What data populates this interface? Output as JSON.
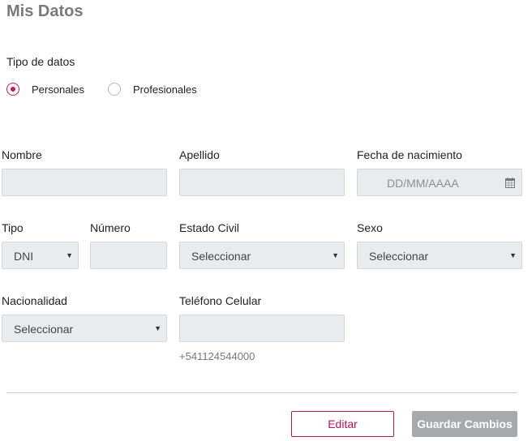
{
  "page": {
    "title": "Mis Datos"
  },
  "tipo_datos": {
    "label": "Tipo de datos",
    "options": [
      {
        "label": "Personales",
        "selected": true
      },
      {
        "label": "Profesionales",
        "selected": false
      }
    ]
  },
  "form": {
    "nombre": {
      "label": "Nombre",
      "value": ""
    },
    "apellido": {
      "label": "Apellido",
      "value": ""
    },
    "fecha": {
      "label": "Fecha de nacimiento",
      "placeholder": "DD/MM/AAAA",
      "icon": "calendar-icon"
    },
    "tipo": {
      "label": "Tipo",
      "value": "DNI"
    },
    "numero": {
      "label": "Número",
      "value": ""
    },
    "estado_civil": {
      "label": "Estado Civil",
      "value": "Seleccionar"
    },
    "sexo": {
      "label": "Sexo",
      "value": "Seleccionar"
    },
    "nacionalidad": {
      "label": "Nacionalidad",
      "value": "Seleccionar"
    },
    "telefono": {
      "label": "Teléfono Celular",
      "value": "",
      "hint": "+541124544000"
    }
  },
  "actions": {
    "edit_label": "Editar",
    "save_label": "Guardar Cambios"
  },
  "colors": {
    "accent": "#c2185b",
    "field_bg": "#e9ecef",
    "disabled_button": "#a7aaad"
  }
}
